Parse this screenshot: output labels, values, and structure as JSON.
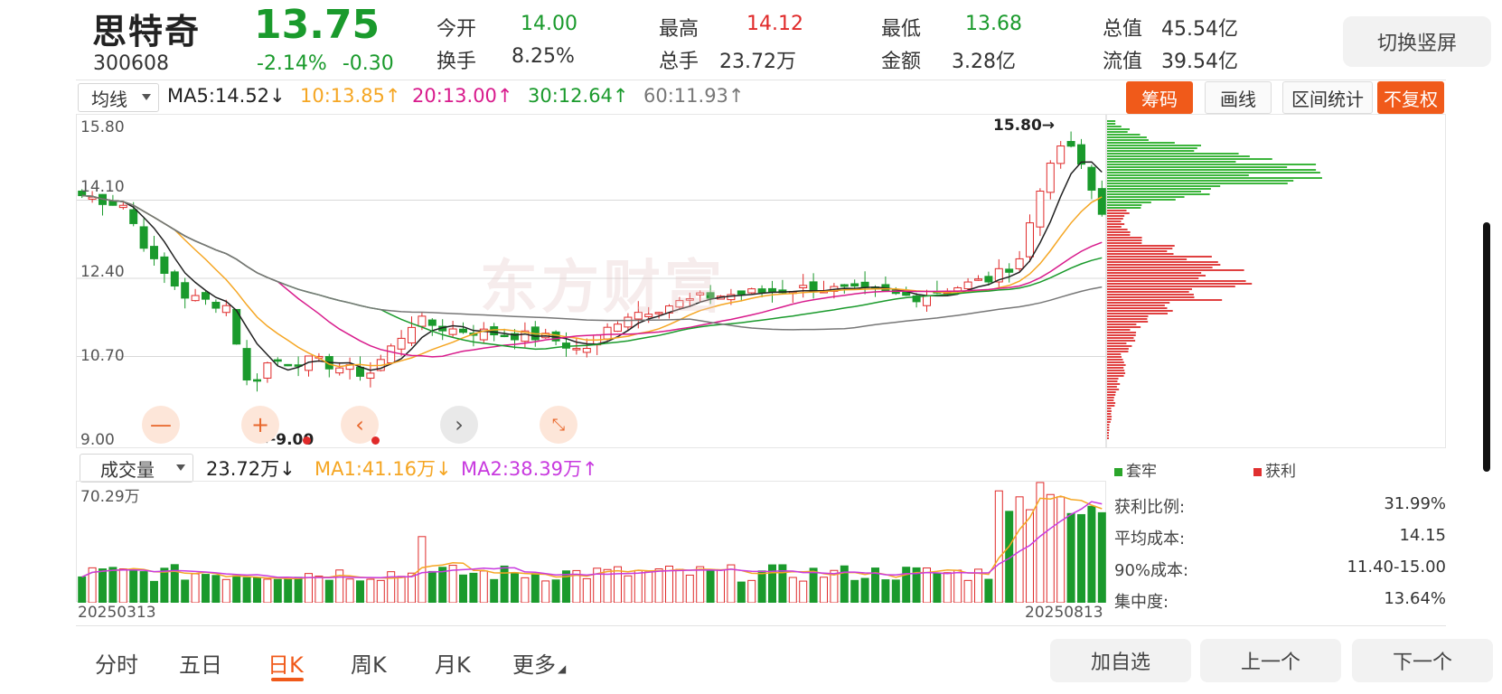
{
  "header": {
    "name": "思特奇",
    "code": "300608",
    "price": "13.75",
    "change_pct": "-2.14%",
    "change_amt": "-0.30",
    "stats": [
      {
        "label": "今开",
        "value": "14.00",
        "tone": "green"
      },
      {
        "label": "最高",
        "value": "14.12",
        "tone": "red"
      },
      {
        "label": "最低",
        "value": "13.68",
        "tone": "green"
      },
      {
        "label": "总值",
        "value": "45.54亿",
        "tone": "dark"
      },
      {
        "label": "换手",
        "value": "8.25%",
        "tone": "dark"
      },
      {
        "label": "总手",
        "value": "23.72万",
        "tone": "dark"
      },
      {
        "label": "金额",
        "value": "3.28亿",
        "tone": "dark"
      },
      {
        "label": "流值",
        "value": "39.54亿",
        "tone": "dark"
      }
    ],
    "switch_button": "切换竖屏"
  },
  "ma_bar": {
    "select": "均线",
    "items": [
      {
        "text": "MA5:14.52↓",
        "color": "#222222"
      },
      {
        "text": "10:13.85↑",
        "color": "#f5a623"
      },
      {
        "text": "20:13.00↑",
        "color": "#d81b8c"
      },
      {
        "text": "30:12.64↑",
        "color": "#1a9a2c"
      },
      {
        "text": "60:11.93↑",
        "color": "#777777"
      }
    ],
    "tools": [
      "筹码",
      "画线",
      "区间统计",
      "不复权"
    ]
  },
  "price_chart": {
    "y_labels": [
      "15.80",
      "14.10",
      "12.40",
      "10.70",
      "9.00"
    ],
    "max_label": "15.80→",
    "min_label": "←9.00",
    "watermark": "东方财富"
  },
  "volume_bar": {
    "select": "成交量",
    "items": [
      {
        "text": "23.72万↓",
        "color": "#222222"
      },
      {
        "text": "MA1:41.16万↓",
        "color": "#f5a623"
      },
      {
        "text": "MA2:38.39万↑",
        "color": "#c83adf"
      }
    ],
    "max_label": "70.29万",
    "start_date": "20250313",
    "end_date": "20250813"
  },
  "chips": {
    "legend": [
      {
        "label": "套牢",
        "color": "#2aa52a"
      },
      {
        "label": "获利",
        "color": "#e03030"
      }
    ],
    "stats": [
      {
        "label": "获利比例:",
        "value": "31.99%"
      },
      {
        "label": "平均成本:",
        "value": "14.15"
      },
      {
        "label": "90%成本:",
        "value": "11.40-15.00"
      },
      {
        "label": "集中度:",
        "value": "13.64%"
      }
    ]
  },
  "tabs": [
    "分时",
    "五日",
    "日K",
    "周K",
    "月K",
    "更多"
  ],
  "active_tab": "日K",
  "bottom_buttons": [
    "加自选",
    "上一个",
    "下一个"
  ],
  "colors": {
    "up": "#e02a2a",
    "down": "#1a9a2c",
    "accent": "#f05a1a"
  }
}
